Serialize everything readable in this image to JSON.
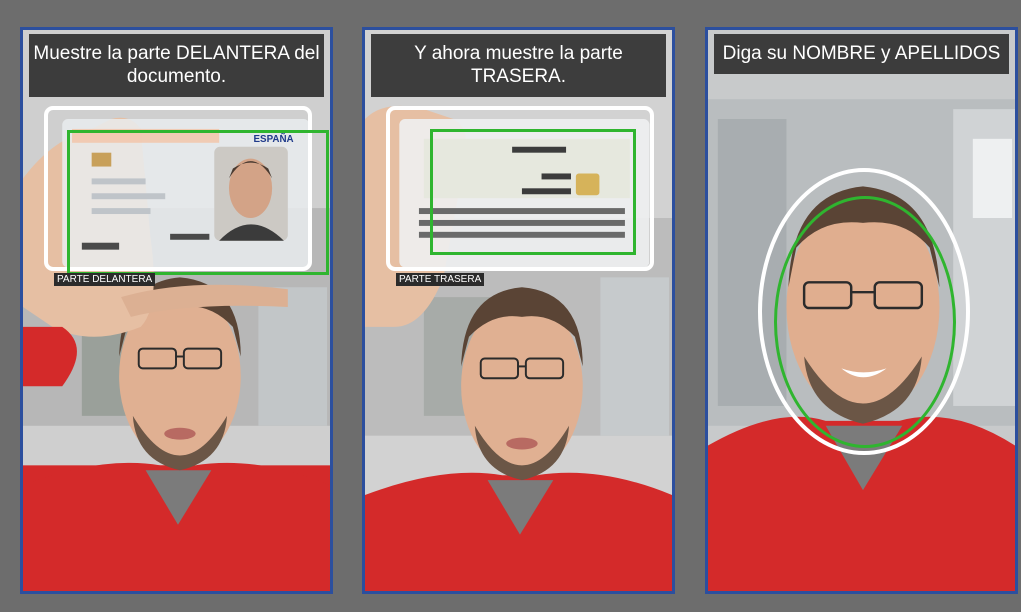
{
  "steps": [
    {
      "instruction": "Muestre la parte DELANTERA del documento.",
      "frame_label": "PARTE DELANTERA",
      "card_side": "front",
      "card_country": "ESPAÑA"
    },
    {
      "instruction": "Y ahora muestre la parte TRASERA.",
      "frame_label": "PARTE TRASERA",
      "card_side": "back"
    },
    {
      "instruction": "Diga su NOMBRE y APELLIDOS",
      "frame_label": "",
      "card_side": "none"
    }
  ],
  "colors": {
    "panel_border": "#2c4f9e",
    "guide_green": "#2fb52f",
    "frame_white": "#ffffff",
    "shirt_red": "#d42a2a",
    "background": "#6d6d6d"
  }
}
